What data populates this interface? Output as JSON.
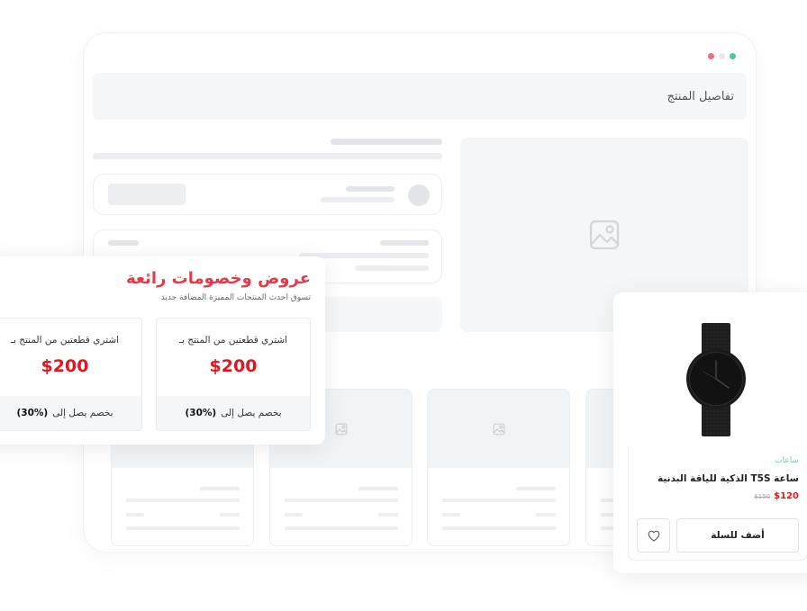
{
  "window": {
    "title": "تفاصيل المنتج",
    "dots": [
      "#f26d7d",
      "#e6e8eb",
      "#4dc89a"
    ]
  },
  "offers": {
    "title": "عروض وخصومات رائعة",
    "subtitle": "تسوق احدث المنتجات المميزة المضافة جديد",
    "deals": [
      {
        "text": "اشتري قطعتين من المنتج بـ",
        "price": "$200",
        "discount_label": "بخصم يصل إلى",
        "discount_value": "(30%)"
      },
      {
        "text": "اشتري قطعتين من المنتج بـ",
        "price": "$200",
        "discount_label": "بخصم يصل إلى",
        "discount_value": "(30%)"
      }
    ]
  },
  "product": {
    "category": "ساعات",
    "name": "ساعة T5S الذكية للياقة البدنية",
    "price": "$120",
    "old_price": "$150",
    "cart_label": "أضف للسلة",
    "image_icon": "watch-image",
    "wishlist_icon": "heart-icon"
  },
  "colors": {
    "accent_red": "#e23b47",
    "price_red": "#e3161f",
    "category_green": "#6bcab0"
  }
}
